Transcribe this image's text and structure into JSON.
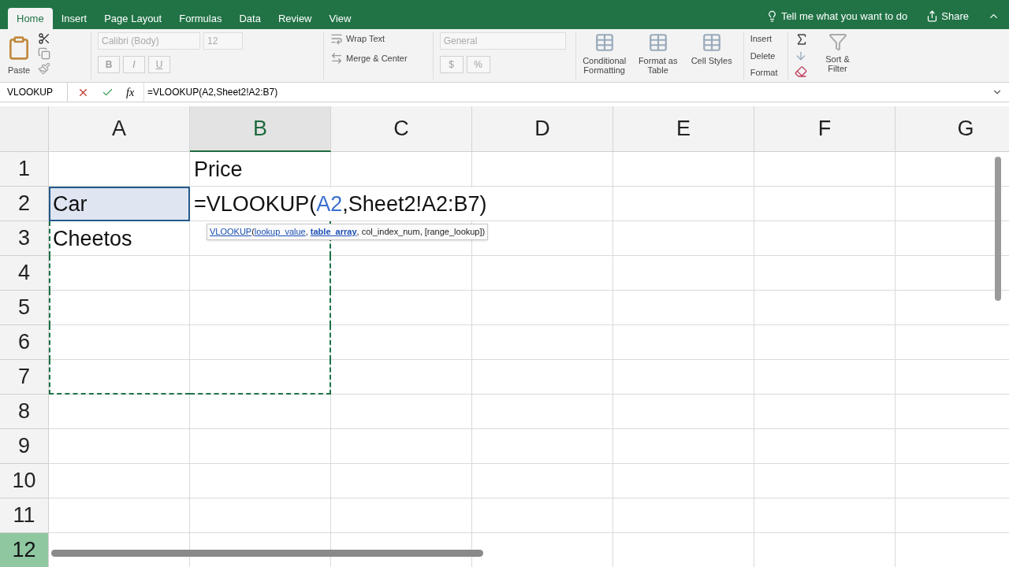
{
  "ribbon_tabs": [
    {
      "label": "Home",
      "selected": true
    },
    {
      "label": "Insert",
      "selected": false
    },
    {
      "label": "Page Layout",
      "selected": false
    },
    {
      "label": "Formulas",
      "selected": false
    },
    {
      "label": "Data",
      "selected": false
    },
    {
      "label": "Review",
      "selected": false
    },
    {
      "label": "View",
      "selected": false
    }
  ],
  "tell_me": {
    "text": "Tell me what you want to do"
  },
  "share_button": {
    "label": "Share"
  },
  "ribbon": {
    "paste": "Paste",
    "font_name": "Calibri (Body)",
    "font_size": "12",
    "bold": "B",
    "italic": "I",
    "underline": "U",
    "wrap_text": "Wrap Text",
    "merge_center": "Merge & Center",
    "number_format": "General",
    "currency": "$",
    "percent": "%",
    "styles": [
      "Conditional Formatting",
      "Format as Table",
      "Cell Styles"
    ],
    "cells": [
      "Insert",
      "Delete",
      "Format"
    ],
    "sort_filter": "Sort & Filter"
  },
  "formula_bar": {
    "name_box": "VLOOKUP",
    "fx": "fx",
    "formula": "=VLOOKUP(A2,Sheet2!A2:B7)"
  },
  "columns": [
    {
      "label": "A",
      "selected": false
    },
    {
      "label": "B",
      "selected": true
    },
    {
      "label": "C",
      "selected": false
    },
    {
      "label": "D",
      "selected": false
    },
    {
      "label": "E",
      "selected": false
    },
    {
      "label": "F",
      "selected": false
    },
    {
      "label": "G",
      "selected": false
    }
  ],
  "rows": [
    {
      "label": "1",
      "selected": false,
      "cells": {
        "B": {
          "text": "Price",
          "active": false,
          "copied": false
        }
      }
    },
    {
      "label": "2",
      "selected": false,
      "cells": {
        "A": {
          "text": "Car",
          "active": true,
          "copied": true
        },
        "B": {
          "active": false,
          "copied": true,
          "editing": true,
          "parts": [
            {
              "text": "=VLOOKUP(",
              "kind": "plain"
            },
            {
              "text": "A2",
              "kind": "reference"
            },
            {
              "text": ",Sheet2!A2:B7)",
              "kind": "plain"
            }
          ],
          "tooltip": [
            {
              "text": "VLOOKUP",
              "kind": "link"
            },
            {
              "text": "(",
              "kind": "plain"
            },
            {
              "text": "lookup_value",
              "kind": "link"
            },
            {
              "text": ", ",
              "kind": "plain"
            },
            {
              "text": "table_array",
              "kind": "bold_link"
            },
            {
              "text": ", col_index_num, [range_lookup])",
              "kind": "plain"
            }
          ]
        }
      }
    },
    {
      "label": "3",
      "selected": false,
      "cells": {
        "A": {
          "text": "Cheetos",
          "active": false,
          "copied": true
        },
        "B": {
          "active": false,
          "copied": true
        }
      }
    },
    {
      "label": "4",
      "selected": false,
      "cells": {
        "A": {
          "active": false,
          "copied": true
        },
        "B": {
          "active": false,
          "copied": true
        }
      }
    },
    {
      "label": "5",
      "selected": false,
      "cells": {
        "A": {
          "active": false,
          "copied": true
        },
        "B": {
          "active": false,
          "copied": true
        }
      }
    },
    {
      "label": "6",
      "selected": false,
      "cells": {
        "A": {
          "active": false,
          "copied": true
        },
        "B": {
          "active": false,
          "copied": true
        }
      }
    },
    {
      "label": "7",
      "selected": false,
      "cells": {
        "A": {
          "active": false,
          "copied": true
        },
        "B": {
          "active": false,
          "copied": true
        }
      }
    },
    {
      "label": "8",
      "selected": false,
      "cells": {}
    },
    {
      "label": "9",
      "selected": false,
      "cells": {}
    },
    {
      "label": "10",
      "selected": false,
      "cells": {}
    },
    {
      "label": "11",
      "selected": false,
      "cells": {}
    },
    {
      "label": "12",
      "selected": true,
      "cells": {}
    }
  ]
}
